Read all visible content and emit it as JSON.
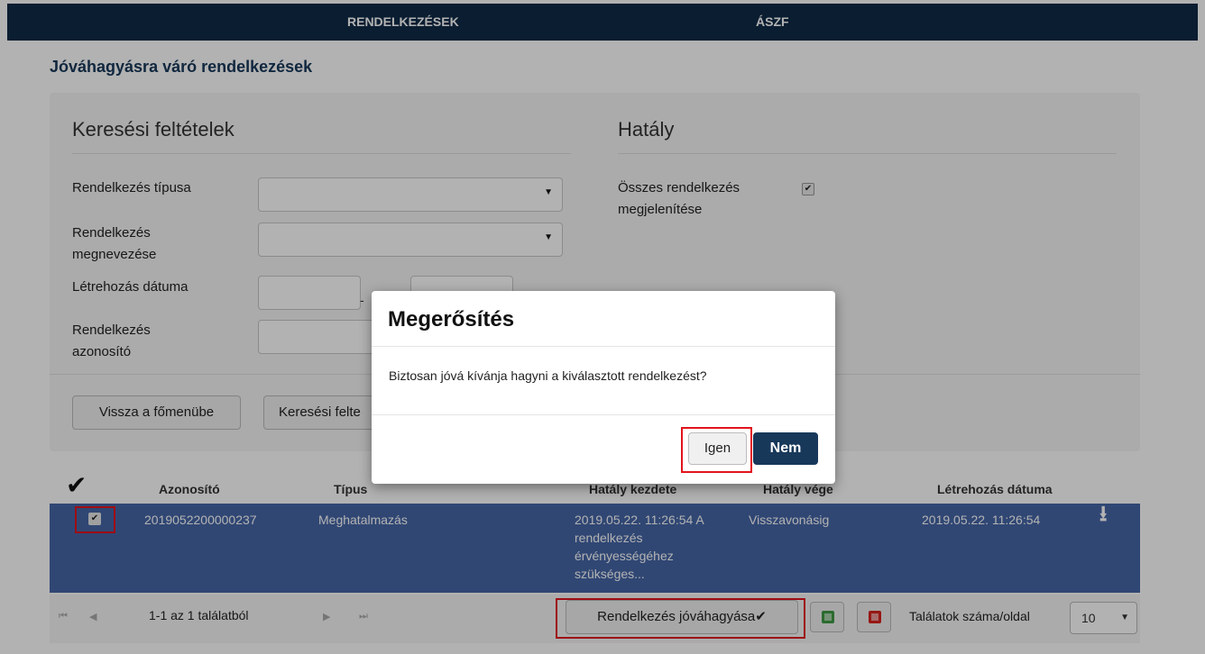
{
  "nav": {
    "item1": "RENDELKEZÉSEK",
    "item2": "ÁSZF"
  },
  "page_title": "Jóváhagyásra váró rendelkezések",
  "search": {
    "title": "Keresési feltételek",
    "type_label": "Rendelkezés típusa",
    "name_label_1": "Rendelkezés",
    "name_label_2": "megnevezése",
    "date_label": "Létrehozás dátuma",
    "date_separator": "-",
    "id_label_1": "Rendelkezés",
    "id_label_2": "azonosító"
  },
  "scope": {
    "title": "Hatály",
    "show_all_label_1": "Összes rendelkezés",
    "show_all_label_2": "megjelenítése",
    "show_all_checked": "✔"
  },
  "buttons": {
    "back": "Vissza a főmenübe",
    "criteria": "Keresési felte"
  },
  "table": {
    "check_header": "✔",
    "headers": {
      "id": "Azonosító",
      "type": "Típus",
      "start": "Hatály kezdete",
      "end": "Hatály vége",
      "created": "Létrehozás dátuma"
    },
    "row": {
      "checked": "✔",
      "id": "2019052200000237",
      "type": "Meghatalmazás",
      "start_1": "2019.05.22. 11:26:54 A",
      "start_2": "rendelkezés",
      "start_3": "érvényességéhez",
      "start_4": "szükséges...",
      "end": "Visszavonásig",
      "created": "2019.05.22. 11:26:54",
      "download_icon": "⭳"
    }
  },
  "pager": {
    "first": "⏮",
    "prev": "◀",
    "info": "1-1 az 1 találatból",
    "next": "▶",
    "last": "⏭",
    "approve": "Rendelkezés jóváhagyása✔",
    "per_page_label": "Találatok száma/oldal",
    "per_page_value": "10"
  },
  "modal": {
    "title": "Megerősítés",
    "message": "Biztosan jóvá kívánja hagyni a kiválasztott rendelkezést?",
    "yes": "Igen",
    "no": "Nem"
  },
  "colors": {
    "nav_bg": "#0f2a47",
    "selected_row": "#4666a6",
    "primary_button": "#18385a",
    "highlight": "#e3141c"
  }
}
